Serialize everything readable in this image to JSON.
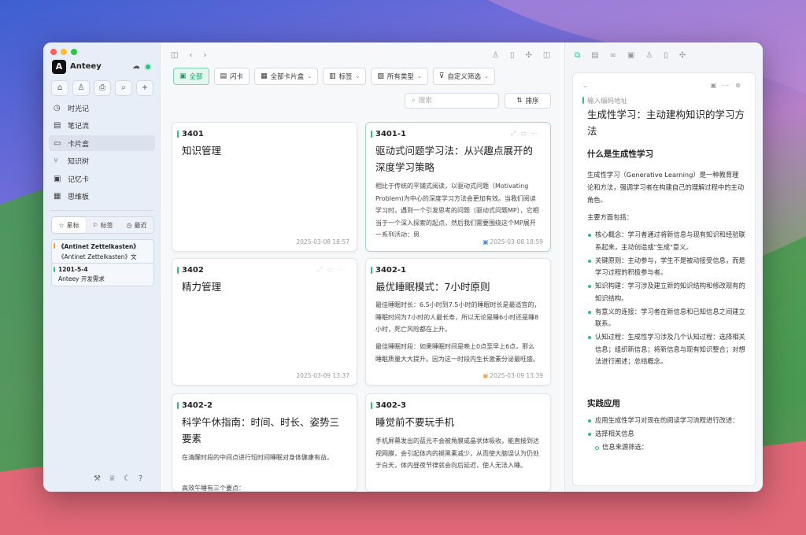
{
  "app": {
    "name": "Anteey",
    "logo": "A"
  },
  "sidebar": {
    "nav": [
      {
        "icon": "clock-icon",
        "glyph": "◷",
        "label": "时光记"
      },
      {
        "icon": "notebook-icon",
        "glyph": "▤",
        "label": "笔记流"
      },
      {
        "icon": "card-box-icon",
        "glyph": "▭",
        "label": "卡片盒"
      },
      {
        "icon": "knowledge-tree-icon",
        "glyph": "⑂",
        "label": "知识树"
      },
      {
        "icon": "memory-card-icon",
        "glyph": "▣",
        "label": "记忆卡"
      },
      {
        "icon": "mindmap-icon",
        "glyph": "▦",
        "label": "思维板"
      }
    ],
    "tabs": {
      "starred": "星标",
      "tags": "标签",
      "recent": "最近"
    },
    "starred_items": [
      {
        "title": "《Antinet Zettelkasten》",
        "subtitle": "《Antinet Zettelkasten》文"
      },
      {
        "title": "1201-5-4",
        "subtitle": "Anteey 开发需求"
      }
    ]
  },
  "filters": {
    "all": "全部",
    "flash": "闪卡",
    "all_boxes": "全部卡片盒",
    "tags": "标签",
    "all_types": "所有类型",
    "custom": "自定义筛选",
    "search_placeholder": "搜索",
    "sort": "排序"
  },
  "cards": [
    {
      "id": "3401",
      "title": "知识管理",
      "body": "",
      "date": "2025-03-08 18:57"
    },
    {
      "id": "3401-1",
      "title": "驱动式问题学习法：从兴趣点展开的深度学习策略",
      "body": "相比于传统的平铺式阅读，以驱动式问题（Motivating Problem)为中心的深度学习方法会更加有效。当我们阅读学习时，遇到一个引发思考的问题（驱动式问题MP），它相当于一个深入探索的起点，然后我们需要围绕这个MP展开一系列活动：思",
      "date": "2025-03-08 18:59"
    },
    {
      "id": "3402",
      "title": "精力管理",
      "body": "",
      "date": "2025-03-09 13:37"
    },
    {
      "id": "3402-1",
      "title": "最优睡眠模式：7小时原则",
      "body": "最佳睡眠时长：6.5小时到7.5小时的睡眠时长是最适宜的，睡眠时间为7小时的人最长寿，所以无论是睡6小时还是睡8小时，死亡风险都在上升。",
      "body2": "最佳睡眠时段：如果睡眠时间是晚上0点至早上6点，那么睡眠质量大大提升。因为这一时段内生长激素分泌最旺盛。",
      "date": "2025-03-09 13:39"
    },
    {
      "id": "3402-2",
      "title": "科学午休指南：时间、时长、姿势三要素",
      "body": "在清醒时段的中间点进行短时间睡眠对身体健康有益。",
      "body2": "高效午睡有三个要点：",
      "date": ""
    },
    {
      "id": "3402-3",
      "title": "睡觉前不要玩手机",
      "body": "手机屏幕发出的蓝光不会被角膜或晶状体吸收，能直接到达视网膜，会引起体内的褪黑素减少，从而使大脑误认为仍处于白天，体内昼夜节律就会向后延迟，使人无法入睡。",
      "date": ""
    }
  ],
  "detail": {
    "address_placeholder": "输入编码地址",
    "title": "生成性学习：主动建构知识的学习方法",
    "h1": "什么是生成性学习",
    "p1": "生成性学习（Generative Learning）是一种教育理论和方法，强调学习者在构建自己的理解过程中的主动角色。",
    "p2": "主要方面包括：",
    "points": [
      "核心概念：学习者通过将新信息与现有知识和经验联系起来，主动创造或\"生成\"意义。",
      "关键原则：主动参与，学生不是被动接受信息，而是学习过程的积极参与者。",
      "知识构建：学习涉及建立新的知识结构和修改现有的知识结构。",
      "有意义的连接：学习者在新信息和已知信息之间建立联系。",
      "认知过程：生成性学习涉及几个认知过程：选择相关信息；组织新信息；将新信息与现有知识整合；对想法进行阐述；总结概念。"
    ],
    "h2": "实践应用",
    "practice": [
      "应用生成性学习对现在的阅读学习流程进行改进：",
      "选择相关信息"
    ],
    "practice_sub": "信息来源筛选："
  }
}
